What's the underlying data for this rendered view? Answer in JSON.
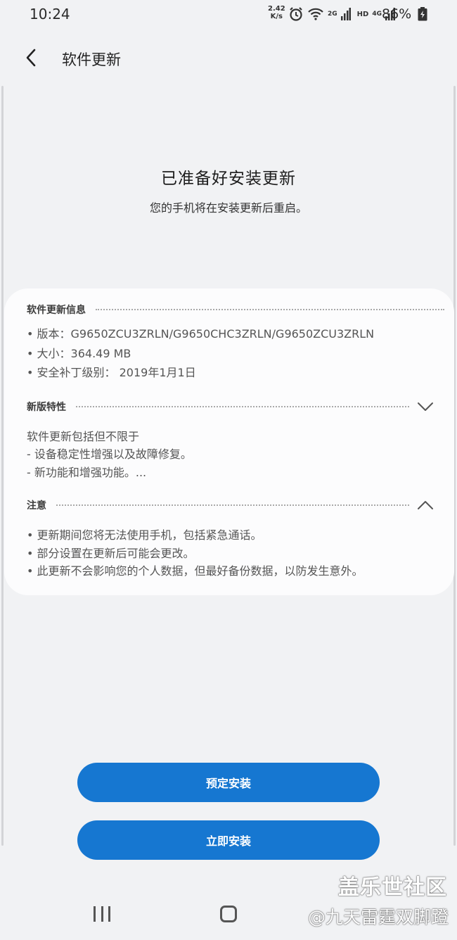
{
  "status_bar": {
    "time": "10:24",
    "speed_value": "2.42",
    "speed_unit": "K/s",
    "network_2g": "2G",
    "network_hd": "HD",
    "network_4g": "4G",
    "battery_percent": "86%",
    "icons": [
      "alarm-icon",
      "wifi-icon",
      "signal-icon",
      "battery-charging-icon"
    ]
  },
  "header": {
    "title": "软件更新",
    "back_icon": "chevron-left-icon"
  },
  "hero": {
    "title": "已准备好安装更新",
    "subtitle": "您的手机将在安装更新后重启。"
  },
  "update_info": {
    "title": "软件更新信息",
    "version": "• 版本：G9650ZCU3ZRLN/G9650CHC3ZRLN/G9650ZCU3ZRLN",
    "size": "• 大小：364.49 MB",
    "security_patch": "• 安全补丁级别： 2019年1月1日"
  },
  "features": {
    "title": "新版特性",
    "chevron": "chevron-down-icon",
    "lines": [
      "软件更新包括但不限于",
      "- 设备稳定性增强以及故障修复。",
      "- 新功能和增强功能。..."
    ]
  },
  "notes": {
    "title": "注意",
    "chevron": "chevron-up-icon",
    "lines": [
      "• 更新期间您将无法使用手机，包括紧急通话。",
      "• 部分设置在更新后可能会更改。",
      "• 此更新不会影响您的个人数据，但最好备份数据，以防发生意外。"
    ]
  },
  "buttons": {
    "schedule": "预定安装",
    "install_now": "立即安装"
  },
  "watermark": {
    "line1": "盖乐世社区",
    "line2": "@九天雷霆双脚蹬"
  },
  "colors": {
    "accent": "#1677d1",
    "background": "#f1f2f4",
    "card": "#fcfcfd"
  }
}
